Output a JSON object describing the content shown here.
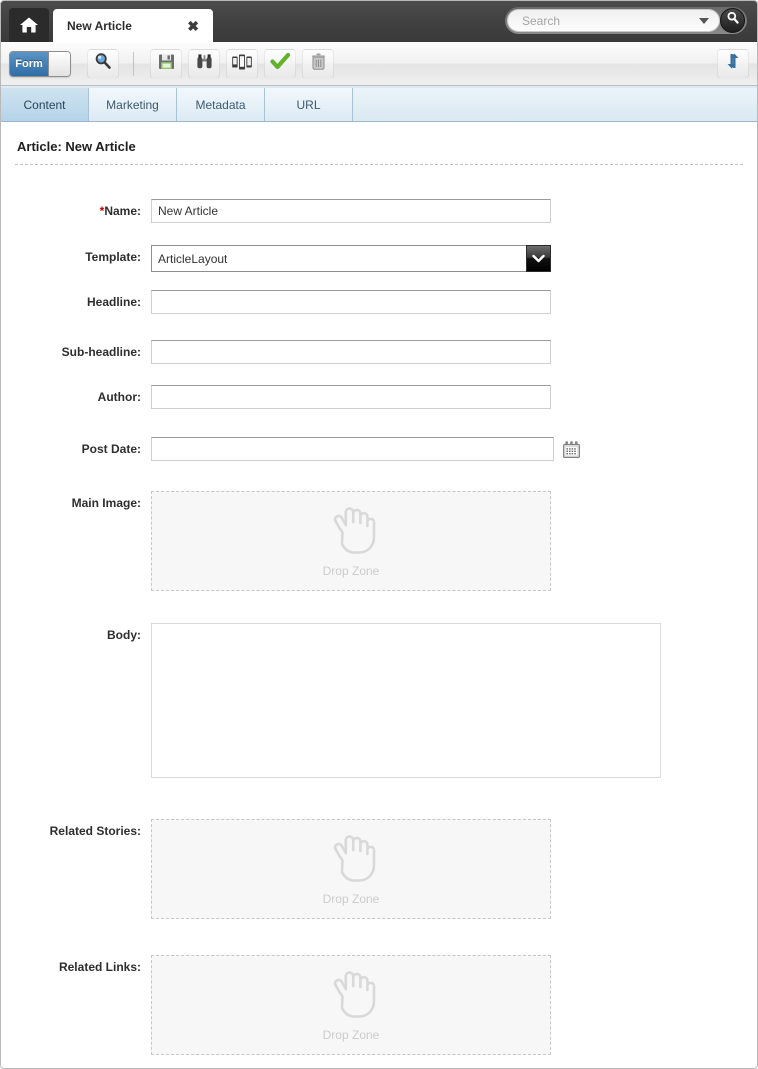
{
  "titlebar": {
    "home_icon": "home-icon",
    "tab": {
      "label": "New Article",
      "close_label": "✖"
    }
  },
  "search": {
    "placeholder": "Search",
    "value": "",
    "dropdown_icon": "chevron-down-icon",
    "submit_icon": "search-icon"
  },
  "toolbar": {
    "mode_toggle": {
      "label": "Form",
      "state": "on"
    },
    "buttons": [
      {
        "name": "preview-button",
        "icon": "magnifier-icon",
        "label": "Preview"
      },
      {
        "name": "save-button",
        "icon": "floppy-disk-icon",
        "label": "Save"
      },
      {
        "name": "compare-button",
        "icon": "binoculars-icon",
        "label": "Compare"
      },
      {
        "name": "devices-button",
        "icon": "devices-icon",
        "label": "Devices"
      },
      {
        "name": "approve-button",
        "icon": "green-check-icon",
        "label": "Approve"
      },
      {
        "name": "delete-button",
        "icon": "trash-can-icon",
        "label": "Delete"
      }
    ],
    "refresh": {
      "name": "refresh-button",
      "icon": "sync-arrows-icon",
      "label": "Refresh"
    }
  },
  "tabs": [
    {
      "label": "Content",
      "active": true
    },
    {
      "label": "Marketing",
      "active": false
    },
    {
      "label": "Metadata",
      "active": false
    },
    {
      "label": "URL",
      "active": false
    }
  ],
  "page": {
    "title": "Article: New Article"
  },
  "form": {
    "fields": [
      {
        "id": "name",
        "label": "Name:",
        "required": true,
        "type": "text",
        "value": "New Article",
        "placeholder": ""
      },
      {
        "id": "template",
        "label": "Template:",
        "required": false,
        "type": "select",
        "value": "ArticleLayout"
      },
      {
        "id": "headline",
        "label": "Headline:",
        "required": false,
        "type": "text",
        "value": "",
        "placeholder": ""
      },
      {
        "id": "subheadline",
        "label": "Sub-headline:",
        "required": false,
        "type": "text",
        "value": "",
        "placeholder": ""
      },
      {
        "id": "author",
        "label": "Author:",
        "required": false,
        "type": "text",
        "value": "",
        "placeholder": ""
      },
      {
        "id": "postdate",
        "label": "Post Date:",
        "required": false,
        "type": "date",
        "value": "",
        "placeholder": ""
      },
      {
        "id": "mainimage",
        "label": "Main Image:",
        "required": false,
        "type": "dropzone",
        "dropzone_label": "Drop Zone"
      },
      {
        "id": "body",
        "label": "Body:",
        "required": false,
        "type": "richtext",
        "value": ""
      },
      {
        "id": "relatedstories",
        "label": "Related Stories:",
        "required": false,
        "type": "dropzone",
        "dropzone_label": "Drop Zone"
      },
      {
        "id": "relatedlinks",
        "label": "Related Links:",
        "required": false,
        "type": "dropzone",
        "dropzone_label": "Drop Zone"
      }
    ],
    "required_marker": "*"
  },
  "colors": {
    "accent_blue": "#2f6ea6",
    "titlebar": "#414141",
    "tab_active": "#b4d4e8",
    "required_red": "#c00000",
    "dropzone_text": "#cccccc"
  }
}
